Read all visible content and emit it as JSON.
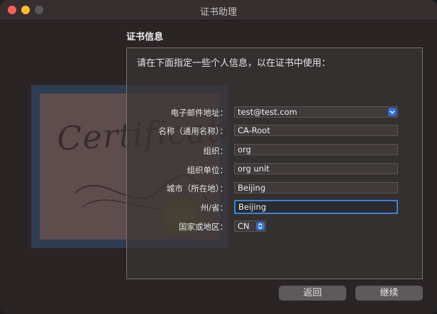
{
  "window": {
    "title": "证书助理"
  },
  "section_title": "证书信息",
  "prompt": "请在下面指定一些个人信息，以在证书中使用：",
  "certificate_art": {
    "word": "Certificate"
  },
  "form": {
    "email": {
      "label": "电子邮件地址：",
      "value": "test@test.com"
    },
    "name": {
      "label": "名称（通用名称）：",
      "value": "CA-Root"
    },
    "org": {
      "label": "组织：",
      "value": "org"
    },
    "org_unit": {
      "label": "组织单位：",
      "value": "org unit"
    },
    "city": {
      "label": "城市（所在地）：",
      "value": "Beijing"
    },
    "state": {
      "label": "州/省：",
      "value": "Beijing"
    },
    "country": {
      "label": "国家或地区：",
      "value": "CN"
    }
  },
  "buttons": {
    "back": "返回",
    "continue": "继续"
  },
  "colors": {
    "accent": "#3b82d6",
    "close": "#ff5f57",
    "minimize": "#febc2e"
  }
}
